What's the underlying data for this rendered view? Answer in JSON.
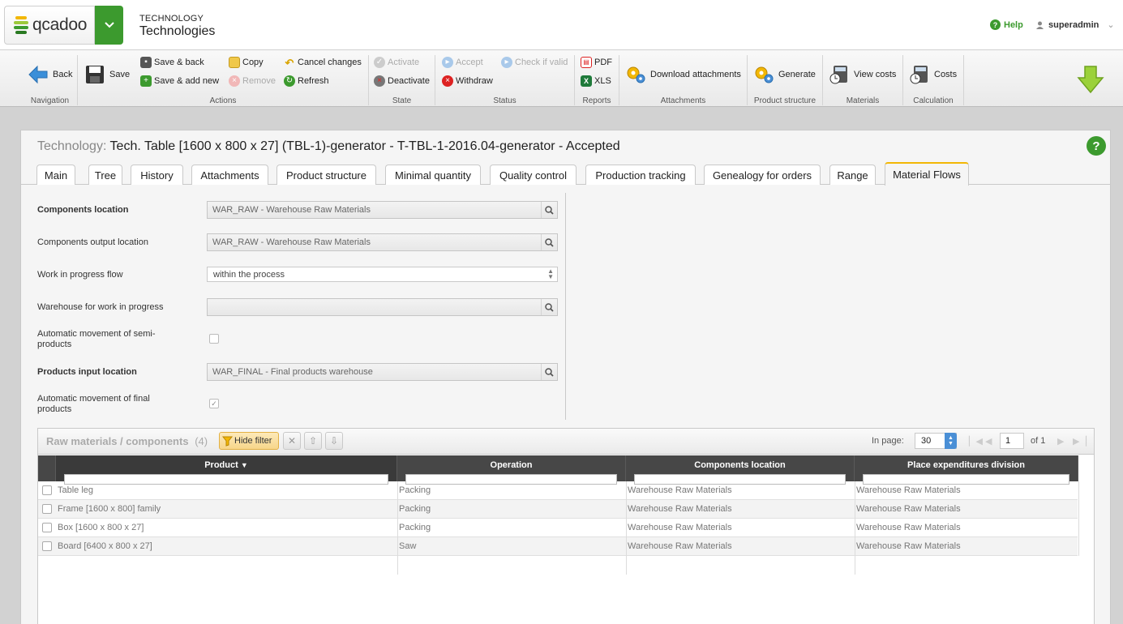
{
  "header": {
    "logo_text": "qcadoo",
    "breadcrumb_sub": "TECHNOLOGY",
    "breadcrumb_main": "Technologies",
    "help_label": "Help",
    "user_name": "superadmin"
  },
  "ribbon": {
    "navigation": {
      "label": "Navigation",
      "back": "Back"
    },
    "actions": {
      "label": "Actions",
      "save": "Save",
      "save_back": "Save & back",
      "save_add_new": "Save & add new",
      "copy": "Copy",
      "remove": "Remove",
      "cancel_changes": "Cancel changes",
      "refresh": "Refresh"
    },
    "state": {
      "label": "State",
      "activate": "Activate",
      "deactivate": "Deactivate"
    },
    "status": {
      "label": "Status",
      "accept": "Accept",
      "check_if_valid": "Check if valid",
      "withdraw": "Withdraw"
    },
    "reports": {
      "label": "Reports",
      "pdf": "PDF",
      "xls": "XLS"
    },
    "attachments": {
      "label": "Attachments",
      "download": "Download attachments"
    },
    "product_structure": {
      "label": "Product structure",
      "generate": "Generate"
    },
    "materials": {
      "label": "Materials",
      "view_costs": "View costs"
    },
    "calculation": {
      "label": "Calculation",
      "costs": "Costs"
    }
  },
  "panel": {
    "title_label": "Technology:",
    "title_value": "Tech. Table [1600 x 800 x 27] (TBL-1)-generator - T-TBL-1-2016.04-generator - Accepted",
    "tabs": [
      "Main",
      "Tree",
      "History",
      "Attachments",
      "Product structure",
      "Minimal quantity",
      "Quality control",
      "Production tracking",
      "Genealogy for orders",
      "Range",
      "Material Flows"
    ],
    "active_tab": "Material Flows"
  },
  "form": {
    "components_location": {
      "label": "Components location",
      "value": "WAR_RAW - Warehouse Raw Materials"
    },
    "components_output_location": {
      "label": "Components output location",
      "value": "WAR_RAW - Warehouse Raw Materials"
    },
    "wip_flow": {
      "label": "Work in progress flow",
      "value": "within the process"
    },
    "wip_warehouse": {
      "label": "Warehouse for work in progress",
      "value": ""
    },
    "auto_semi": {
      "label": "Automatic movement of semi-products",
      "checked": false
    },
    "products_input_location": {
      "label": "Products input location",
      "value": "WAR_FINAL - Final products warehouse"
    },
    "auto_final": {
      "label": "Automatic movement of final products",
      "checked": true
    }
  },
  "grid": {
    "title": "Raw materials / components",
    "count": "(4)",
    "hide_filter": "Hide filter",
    "in_page_label": "In page:",
    "page_size": "30",
    "page_number": "1",
    "page_of": "of 1",
    "columns": [
      "Product",
      "Operation",
      "Components location",
      "Place expenditures division"
    ],
    "sorted_column": "Product",
    "rows": [
      {
        "product": "Table leg",
        "operation": "Packing",
        "location": "Warehouse Raw Materials",
        "division": "Warehouse Raw Materials"
      },
      {
        "product": "Frame [1600 x 800] family",
        "operation": "Packing",
        "location": "Warehouse Raw Materials",
        "division": "Warehouse Raw Materials"
      },
      {
        "product": "Box [1600 x 800 x 27]",
        "operation": "Packing",
        "location": "Warehouse Raw Materials",
        "division": "Warehouse Raw Materials"
      },
      {
        "product": "Board [6400 x 800 x 27]",
        "operation": "Saw",
        "location": "Warehouse Raw Materials",
        "division": "Warehouse Raw Materials"
      }
    ]
  },
  "colors": {
    "brand_green": "#3c9a2e",
    "accent_yellow": "#f2b705",
    "grid_header": "#3a3a3a"
  }
}
